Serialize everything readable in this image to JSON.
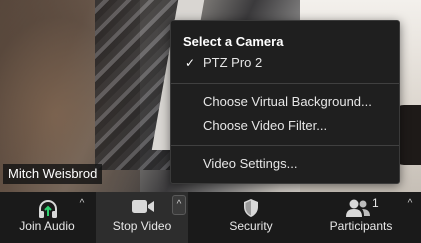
{
  "video": {
    "participant_name": "Mitch Weisbrod"
  },
  "camera_menu": {
    "title": "Select a Camera",
    "cameras": [
      {
        "label": "PTZ Pro 2",
        "selected": true
      }
    ],
    "items": [
      {
        "label": "Choose Virtual Background..."
      },
      {
        "label": "Choose Video Filter..."
      },
      {
        "label": "Video Settings..."
      }
    ]
  },
  "toolbar": {
    "join_audio": "Join Audio",
    "stop_video": "Stop Video",
    "security": "Security",
    "participants": "Participants",
    "participants_count": "1"
  },
  "colors": {
    "toolbar_bg": "#1a1a1a",
    "menu_bg": "#1f1f1f",
    "audio_arrow": "#2ed06e",
    "text": "#e8e8e8"
  },
  "icons": [
    "headphones-icon",
    "video-camera-icon",
    "shield-icon",
    "participants-icon",
    "chevron-up-icon",
    "checkmark-icon"
  ]
}
